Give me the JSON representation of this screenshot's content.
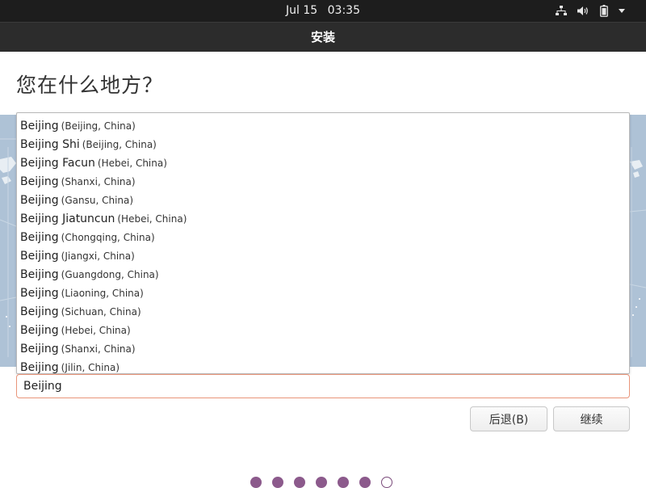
{
  "top_panel": {
    "date": "Jul 15",
    "time": "03:35",
    "icons": [
      "network-icon",
      "volume-icon",
      "battery-icon",
      "system-menu-caret-icon"
    ]
  },
  "window": {
    "title": "安装"
  },
  "page": {
    "heading": "您在什么地方？"
  },
  "location": {
    "input_value": "Beijing",
    "suggestions": [
      {
        "name": "Beijing",
        "region": "(Beijing, China)"
      },
      {
        "name": "Beijing Shi",
        "region": "(Beijing, China)"
      },
      {
        "name": "Beijing Facun",
        "region": "(Hebei, China)"
      },
      {
        "name": "Beijing",
        "region": "(Shanxi, China)"
      },
      {
        "name": "Beijing",
        "region": "(Gansu, China)"
      },
      {
        "name": "Beijing Jiatuncun",
        "region": "(Hebei, China)"
      },
      {
        "name": "Beijing",
        "region": "(Chongqing, China)"
      },
      {
        "name": "Beijing",
        "region": "(Jiangxi, China)"
      },
      {
        "name": "Beijing",
        "region": "(Guangdong, China)"
      },
      {
        "name": "Beijing",
        "region": "(Liaoning, China)"
      },
      {
        "name": "Beijing",
        "region": "(Sichuan, China)"
      },
      {
        "name": "Beijing",
        "region": "(Hebei, China)"
      },
      {
        "name": "Beijing",
        "region": "(Shanxi, China)"
      },
      {
        "name": "Beijing",
        "region": "(Jilin, China)"
      }
    ]
  },
  "buttons": {
    "back": "后退(B)",
    "continue": "继续"
  },
  "progress": {
    "total_steps": 7,
    "current_step": 7
  },
  "colors": {
    "top_panel_bg": "#1d1d1d",
    "header_bg": "#2c2c2c",
    "map_bg": "#aec2d6",
    "input_border": "#e9957a",
    "progress_dot": "#8c5a8c"
  }
}
